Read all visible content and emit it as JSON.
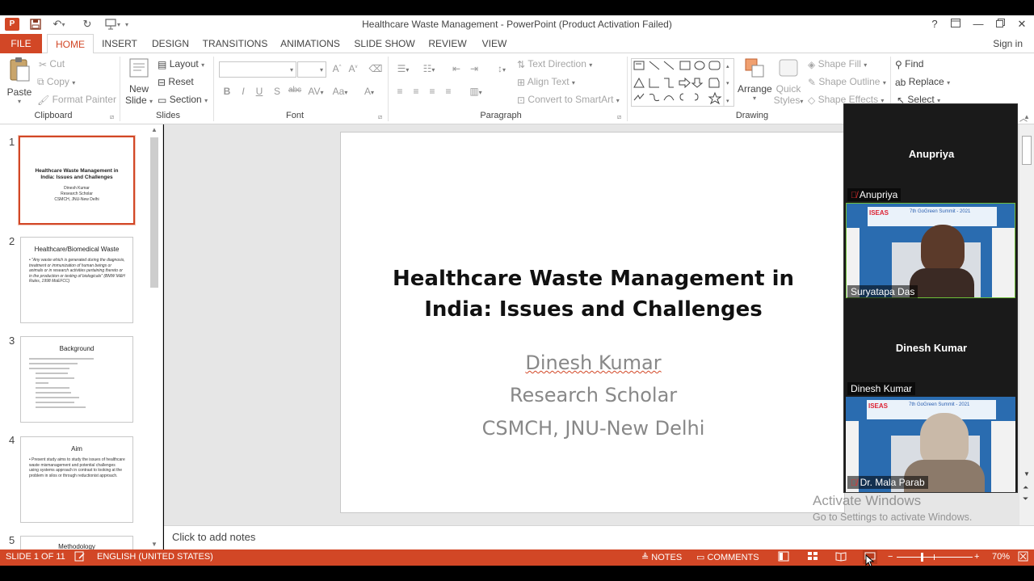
{
  "window": {
    "title": "Healthcare Waste Management - PowerPoint (Product Activation Failed)",
    "signin": "Sign in",
    "help": "?"
  },
  "tabs": [
    "FILE",
    "HOME",
    "INSERT",
    "DESIGN",
    "TRANSITIONS",
    "ANIMATIONS",
    "SLIDE SHOW",
    "REVIEW",
    "VIEW"
  ],
  "ribbon": {
    "clipboard": {
      "label": "Clipboard",
      "paste": "Paste",
      "cut": "Cut",
      "copy": "Copy",
      "format_painter": "Format Painter"
    },
    "slides": {
      "label": "Slides",
      "new_slide_1": "New",
      "new_slide_2": "Slide",
      "layout": "Layout",
      "reset": "Reset",
      "section": "Section"
    },
    "font": {
      "label": "Font"
    },
    "paragraph": {
      "label": "Paragraph",
      "text_direction": "Text Direction",
      "align_text": "Align Text",
      "convert_smartart": "Convert to SmartArt"
    },
    "drawing": {
      "label": "Drawing",
      "arrange": "Arrange",
      "quick_styles_1": "Quick",
      "quick_styles_2": "Styles",
      "shape_fill": "Shape Fill",
      "shape_outline": "Shape Outline",
      "shape_effects": "Shape Effects"
    },
    "editing": {
      "find": "Find",
      "replace": "Replace",
      "select": "Select"
    }
  },
  "thumbnails": [
    {
      "num": "1",
      "title": "Healthcare Waste Management in India: Issues and Challenges",
      "lines": [
        "Dinesh Kumar",
        "Research Scholar",
        "CSMCH, JNU-New Delhi"
      ]
    },
    {
      "num": "2",
      "title": "Healthcare/Biomedical Waste",
      "body": "\"Any waste which is generated during the diagnosis, treatment or immunization of human beings or animals or in research activities pertaining thereto or in the production or testing of biologicals\" (BMW M&H Rules, 1998 MoEFCC)"
    },
    {
      "num": "3",
      "title": "Background"
    },
    {
      "num": "4",
      "title": "Aim",
      "body": "Present study aims to study the issues of healthcare waste mismanagement and potential challenges using systems approach in contrast to looking at the problem in silos or through reductionist approach."
    },
    {
      "num": "5",
      "title": "Methodology"
    }
  ],
  "slide": {
    "title_line1": "Healthcare Waste Management in",
    "title_line2": "India: Issues and Challenges",
    "author": "Dinesh Kumar",
    "role": "Research Scholar",
    "affiliation": "CSMCH, JNU-New Delhi"
  },
  "notes_placeholder": "Click to add notes",
  "video": {
    "tile1_name": "Anupriya",
    "tile1_label": "Anupriya",
    "tile2_label": "Suryatapa Das",
    "tile3_name": "Dinesh Kumar",
    "tile3_label": "Dinesh Kumar",
    "tile4_label": "Dr. Mala Parab",
    "banner_text": "7th GoGreen Summit - 2021",
    "brand": "ISEAS"
  },
  "activate": {
    "line1": "Activate Windows",
    "line2": "Go to Settings to activate Windows."
  },
  "status": {
    "slide_info": "SLIDE 1 OF 11",
    "language": "ENGLISH (UNITED STATES)",
    "notes": "NOTES",
    "comments": "COMMENTS",
    "zoom": "70%"
  },
  "colors": {
    "accent": "#d24726",
    "status_bar": "#d24726"
  }
}
